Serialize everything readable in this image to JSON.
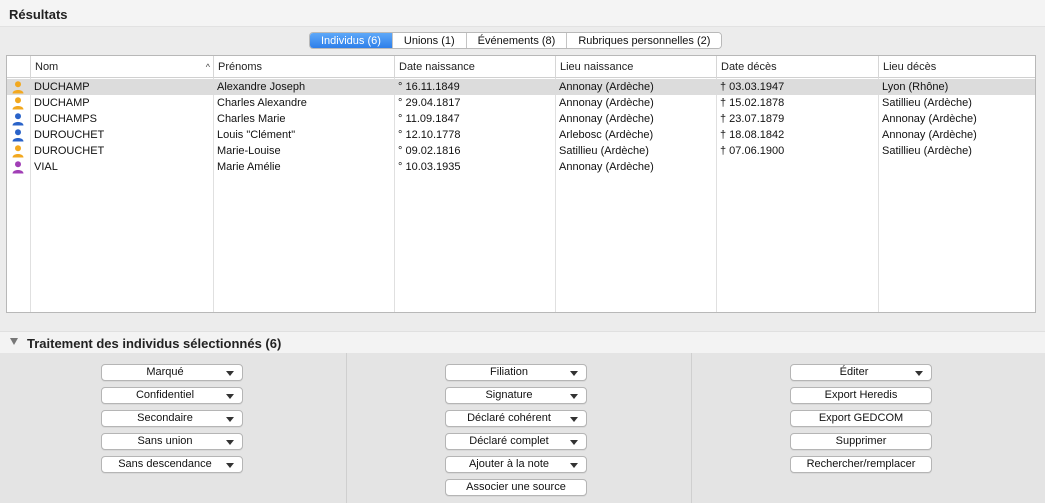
{
  "results": {
    "title": "Résultats",
    "tabs": [
      {
        "label": "Individus (6)",
        "active": true
      },
      {
        "label": "Unions (1)",
        "active": false
      },
      {
        "label": "Événements (8)",
        "active": false
      },
      {
        "label": "Rubriques personnelles (2)",
        "active": false
      }
    ]
  },
  "table": {
    "columns": [
      "Nom",
      "Prénoms",
      "Date naissance",
      "Lieu naissance",
      "Date décès",
      "Lieu décès"
    ],
    "sort_indicator": "^",
    "rows": [
      {
        "icon": "person-female-icon",
        "nom": "DUCHAMP",
        "prenoms": "Alexandre Joseph",
        "date_naissance": "° 16.11.1849",
        "lieu_naissance": "Annonay (Ardèche)",
        "date_deces": "† 03.03.1947",
        "lieu_deces": "Lyon (Rhône)",
        "selected": true
      },
      {
        "icon": "person-female-icon",
        "nom": "DUCHAMP",
        "prenoms": "Charles Alexandre",
        "date_naissance": "° 29.04.1817",
        "lieu_naissance": "Annonay (Ardèche)",
        "date_deces": "† 15.02.1878",
        "lieu_deces": "Satillieu (Ardèche)",
        "selected": false
      },
      {
        "icon": "person-male-icon",
        "nom": "DUCHAMPS",
        "prenoms": "Charles Marie",
        "date_naissance": "° 11.09.1847",
        "lieu_naissance": "Annonay (Ardèche)",
        "date_deces": "† 23.07.1879",
        "lieu_deces": "Annonay (Ardèche)",
        "selected": false
      },
      {
        "icon": "person-male-icon",
        "nom": "DUROUCHET",
        "prenoms": "Louis \"Clément\"",
        "date_naissance": "° 12.10.1778",
        "lieu_naissance": "Arlebosc (Ardèche)",
        "date_deces": "† 18.08.1842",
        "lieu_deces": "Annonay (Ardèche)",
        "selected": false
      },
      {
        "icon": "person-female-icon",
        "nom": "DUROUCHET",
        "prenoms": "Marie-Louise",
        "date_naissance": "° 09.02.1816",
        "lieu_naissance": "Satillieu (Ardèche)",
        "date_deces": "† 07.06.1900",
        "lieu_deces": "Satillieu (Ardèche)",
        "selected": false
      },
      {
        "icon": "person-purple-icon",
        "nom": "VIAL",
        "prenoms": "Marie Amélie",
        "date_naissance": "° 10.03.1935",
        "lieu_naissance": "Annonay (Ardèche)",
        "date_deces": "",
        "lieu_deces": "",
        "selected": false
      }
    ]
  },
  "treatment": {
    "title": "Traitement des individus sélectionnés (6)",
    "col1": [
      {
        "label": "Marqué",
        "dropdown": true
      },
      {
        "label": "Confidentiel",
        "dropdown": true
      },
      {
        "label": "Secondaire",
        "dropdown": true
      },
      {
        "label": "Sans union",
        "dropdown": true
      },
      {
        "label": "Sans descendance",
        "dropdown": true
      }
    ],
    "col2": [
      {
        "label": "Filiation",
        "dropdown": true
      },
      {
        "label": "Signature",
        "dropdown": true
      },
      {
        "label": "Déclaré cohérent",
        "dropdown": true
      },
      {
        "label": "Déclaré complet",
        "dropdown": true
      },
      {
        "label": "Ajouter à la note",
        "dropdown": true
      },
      {
        "label": "Associer une source",
        "dropdown": false
      }
    ],
    "col3": [
      {
        "label": "Éditer",
        "dropdown": true
      },
      {
        "label": "Export Heredis",
        "dropdown": false
      },
      {
        "label": "Export GEDCOM",
        "dropdown": false
      },
      {
        "label": "Supprimer",
        "dropdown": false
      },
      {
        "label": "Rechercher/remplacer",
        "dropdown": false
      }
    ]
  },
  "colors": {
    "tab_active": "#2e7fea",
    "selected_row": "#dcdcdc",
    "male_icon": "#2a63c9",
    "female_icon": "#f2a81f",
    "purple_icon": "#a13fb6"
  }
}
